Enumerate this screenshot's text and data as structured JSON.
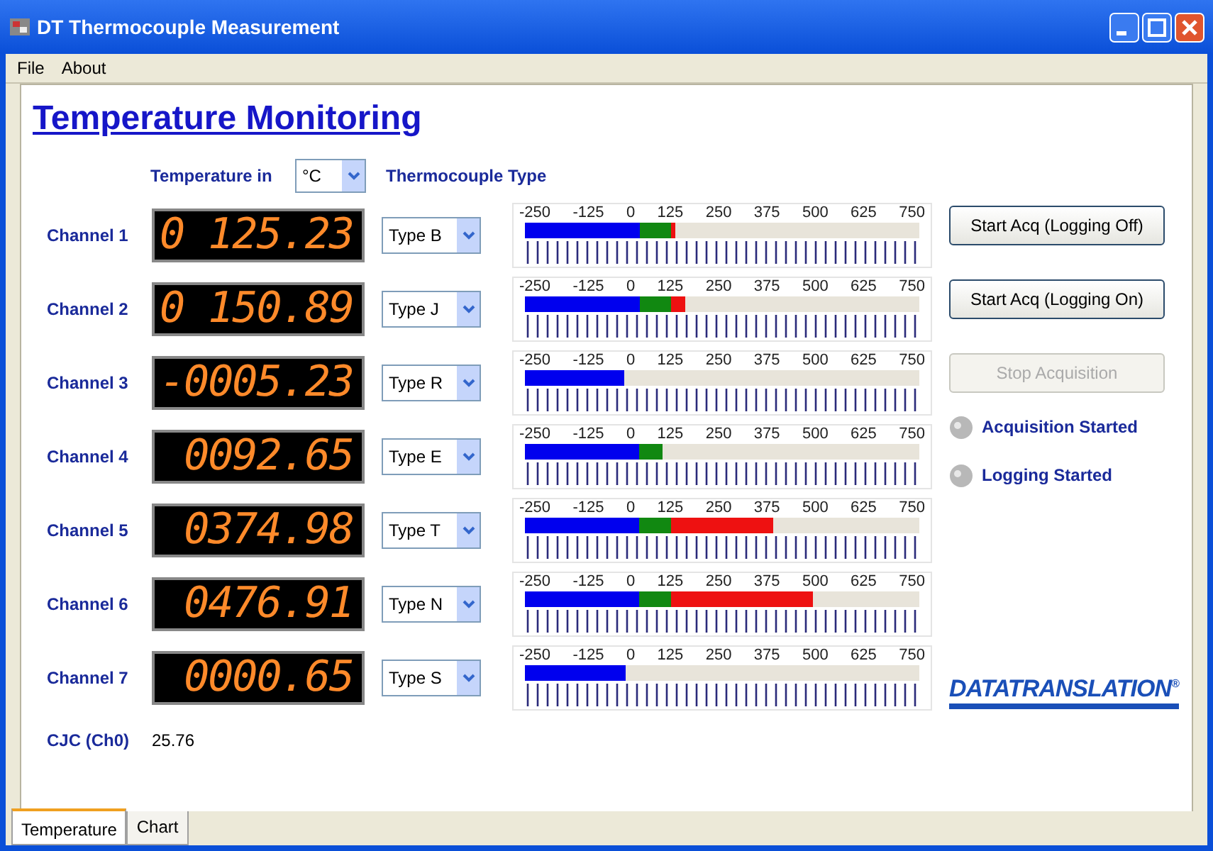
{
  "window": {
    "title": "DT Thermocouple Measurement"
  },
  "menu": [
    "File",
    "About"
  ],
  "heading": "Temperature Monitoring",
  "unit": {
    "label": "Temperature in",
    "value": "°C"
  },
  "type_header": "Thermocouple Type",
  "channels": [
    {
      "name": "Channel 1",
      "reading": "0 125.23",
      "type": "Type B",
      "level": 0.38,
      "scale": [
        "-250",
        "-125",
        "0",
        "125",
        "250",
        "375",
        "500",
        "625",
        "750"
      ]
    },
    {
      "name": "Channel 2",
      "reading": "0 150.89",
      "type": "Type J",
      "level": 0.405,
      "scale": [
        "-250",
        "-125",
        "0",
        "125",
        "250",
        "375",
        "500",
        "625",
        "750"
      ]
    },
    {
      "name": "Channel 3",
      "reading": "-0005.23",
      "type": "Type R",
      "level": 0.25,
      "scale": [
        "-250",
        "-125",
        "0",
        "125",
        "250",
        "375",
        "500",
        "625",
        "750"
      ]
    },
    {
      "name": "Channel 4",
      "reading": "0092.65",
      "type": "Type E",
      "level": 0.35,
      "scale": [
        "-250",
        "-125",
        "0",
        "125",
        "250",
        "375",
        "500",
        "625",
        "750"
      ]
    },
    {
      "name": "Channel 5",
      "reading": "0374.98",
      "type": "Type T",
      "level": 0.63,
      "scale": [
        "-250",
        "-125",
        "0",
        "125",
        "250",
        "375",
        "500",
        "625",
        "750"
      ]
    },
    {
      "name": "Channel 6",
      "reading": "0476.91",
      "type": "Type N",
      "level": 0.73,
      "scale": [
        "-250",
        "-125",
        "0",
        "125",
        "250",
        "375",
        "500",
        "625",
        "750"
      ]
    },
    {
      "name": "Channel 7",
      "reading": "0000.65",
      "type": "Type S",
      "level": 0.255,
      "scale": [
        "-250",
        "-125",
        "0",
        "125",
        "250",
        "375",
        "500",
        "625",
        "750"
      ]
    }
  ],
  "cjc": {
    "label": "CJC (Ch0)",
    "value": "25.76"
  },
  "buttons": [
    {
      "label": "Start Acq (Logging Off)",
      "disabled": false
    },
    {
      "label": "Start Acq (Logging On)",
      "disabled": false
    },
    {
      "label": "Stop Acquisition",
      "disabled": true
    }
  ],
  "indicators": [
    {
      "label": "Acquisition Started",
      "on": false
    },
    {
      "label": "Logging Started",
      "on": false
    }
  ],
  "logo": {
    "text": "DATATRANSLATION",
    "mark": "®"
  },
  "tabs": [
    {
      "label": "Temperature",
      "selected": true
    },
    {
      "label": "Chart",
      "selected": false
    }
  ]
}
